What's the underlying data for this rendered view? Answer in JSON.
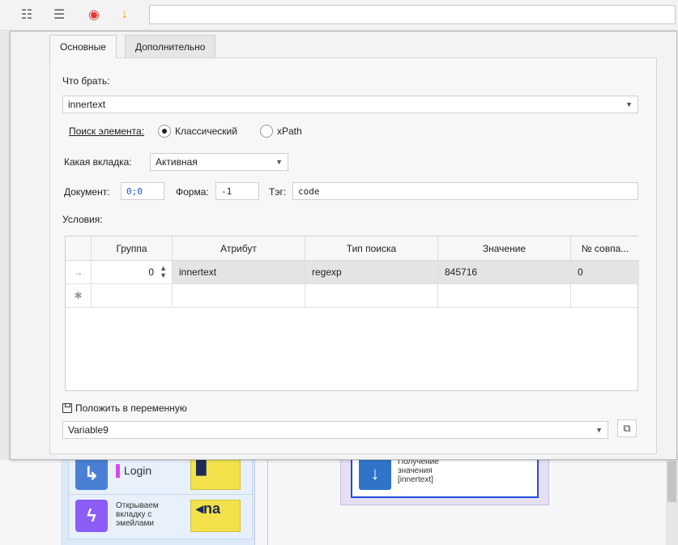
{
  "toolbar": {
    "buttons": [
      {
        "name": "list-settings-icon",
        "glyph": "☷"
      },
      {
        "name": "list-edit-icon",
        "glyph": "☰"
      },
      {
        "name": "record-icon",
        "glyph": "◉",
        "color": "#e53935"
      },
      {
        "name": "download-arrow-icon",
        "glyph": "↓",
        "color": "#f39c12"
      }
    ],
    "search_value": ""
  },
  "tabs": [
    {
      "label": "Основные",
      "active": true
    },
    {
      "label": "Дополнительно",
      "active": false
    }
  ],
  "form": {
    "what_label": "Что брать:",
    "what_value": "innertext",
    "search_label": "Поиск элемента:",
    "radio_classic": "Классический",
    "radio_xpath": "xPath",
    "tab_label": "Какая вкладка:",
    "tab_value": "Активная",
    "doc_label": "Документ:",
    "doc_value": "0;0",
    "form_label": "Форма:",
    "form_value": "-1",
    "tag_label": "Тэг:",
    "tag_value": "code",
    "conditions_label": "Условия:"
  },
  "grid": {
    "columns": [
      "Группа",
      "Атрибут",
      "Тип поиска",
      "Значение",
      "№ совпа..."
    ],
    "rows": [
      {
        "marker": "→",
        "group": "0",
        "attribute": "innertext",
        "search_type": "regexp",
        "value": "845716",
        "match": "0"
      }
    ],
    "new_row_marker": "✱"
  },
  "save": {
    "label": "Положить в переменную",
    "variable": "Variable9"
  },
  "background": {
    "block1_text": "Login",
    "block2_text": "Открываем вкладку с эмейлами",
    "node_text": "Получение значения [innertext]"
  },
  "colors": {
    "accent_blue": "#1d4ed8",
    "block_icon_blue": "#4a7fd6",
    "block_icon_purple": "#8b5cf6"
  }
}
